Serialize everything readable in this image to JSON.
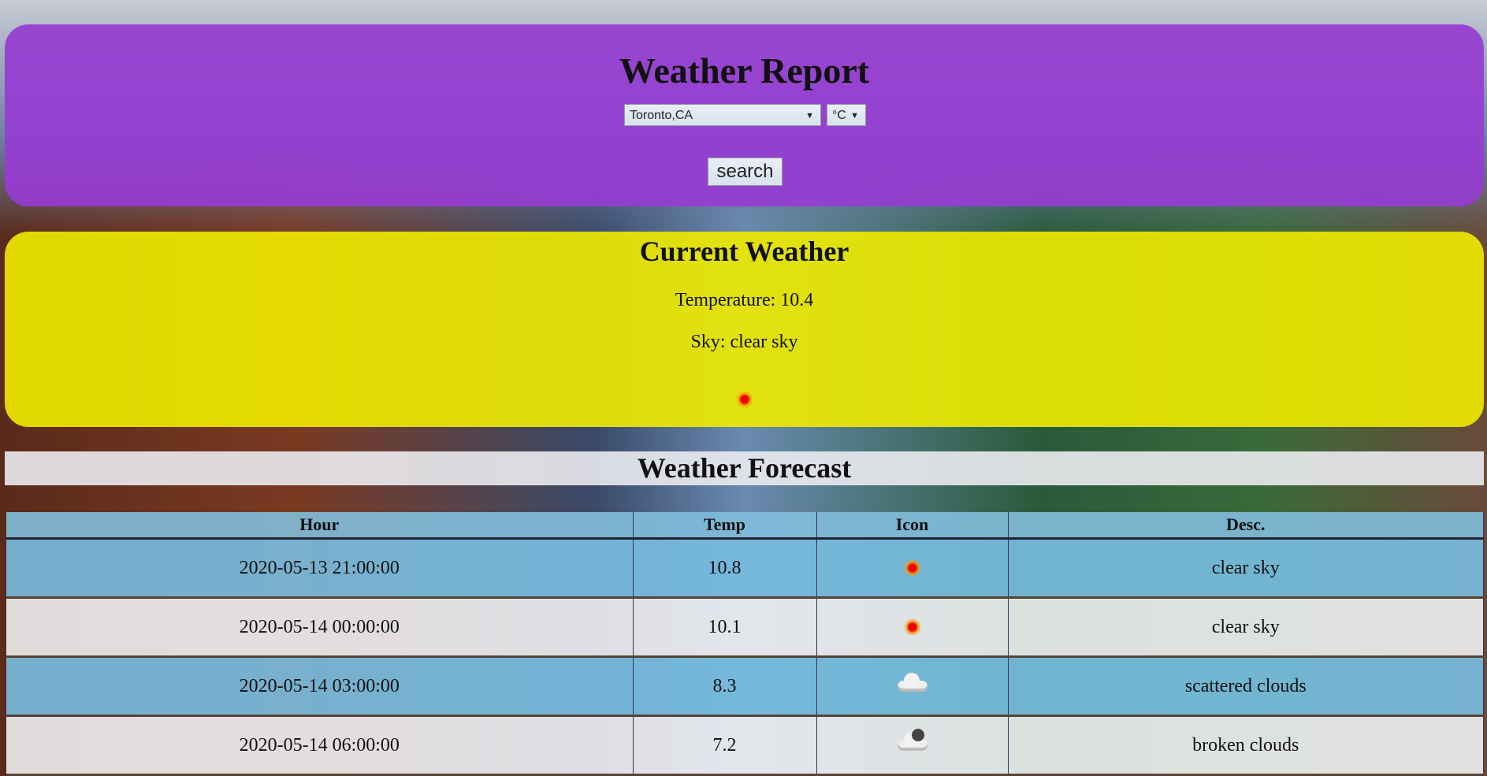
{
  "header": {
    "title": "Weather Report",
    "city_select": "Toronto,CA",
    "unit_select": "°C",
    "search_label": "search"
  },
  "current": {
    "title": "Current Weather",
    "temperature": "Temperature: 10.4",
    "sky": "Sky: clear sky",
    "icon": "sun-icon"
  },
  "forecast": {
    "title": "Weather Forecast",
    "columns": [
      "Hour",
      "Temp",
      "Icon",
      "Desc."
    ],
    "rows": [
      {
        "hour": "2020-05-13 21:00:00",
        "temp": "10.8",
        "icon": "sun-icon",
        "desc": "clear sky"
      },
      {
        "hour": "2020-05-14 00:00:00",
        "temp": "10.1",
        "icon": "sun-icon",
        "desc": "clear sky"
      },
      {
        "hour": "2020-05-14 03:00:00",
        "temp": "8.3",
        "icon": "cloud-icon",
        "desc": "scattered clouds"
      },
      {
        "hour": "2020-05-14 06:00:00",
        "temp": "7.2",
        "icon": "broken-clouds-icon",
        "desc": "broken clouds"
      }
    ]
  }
}
